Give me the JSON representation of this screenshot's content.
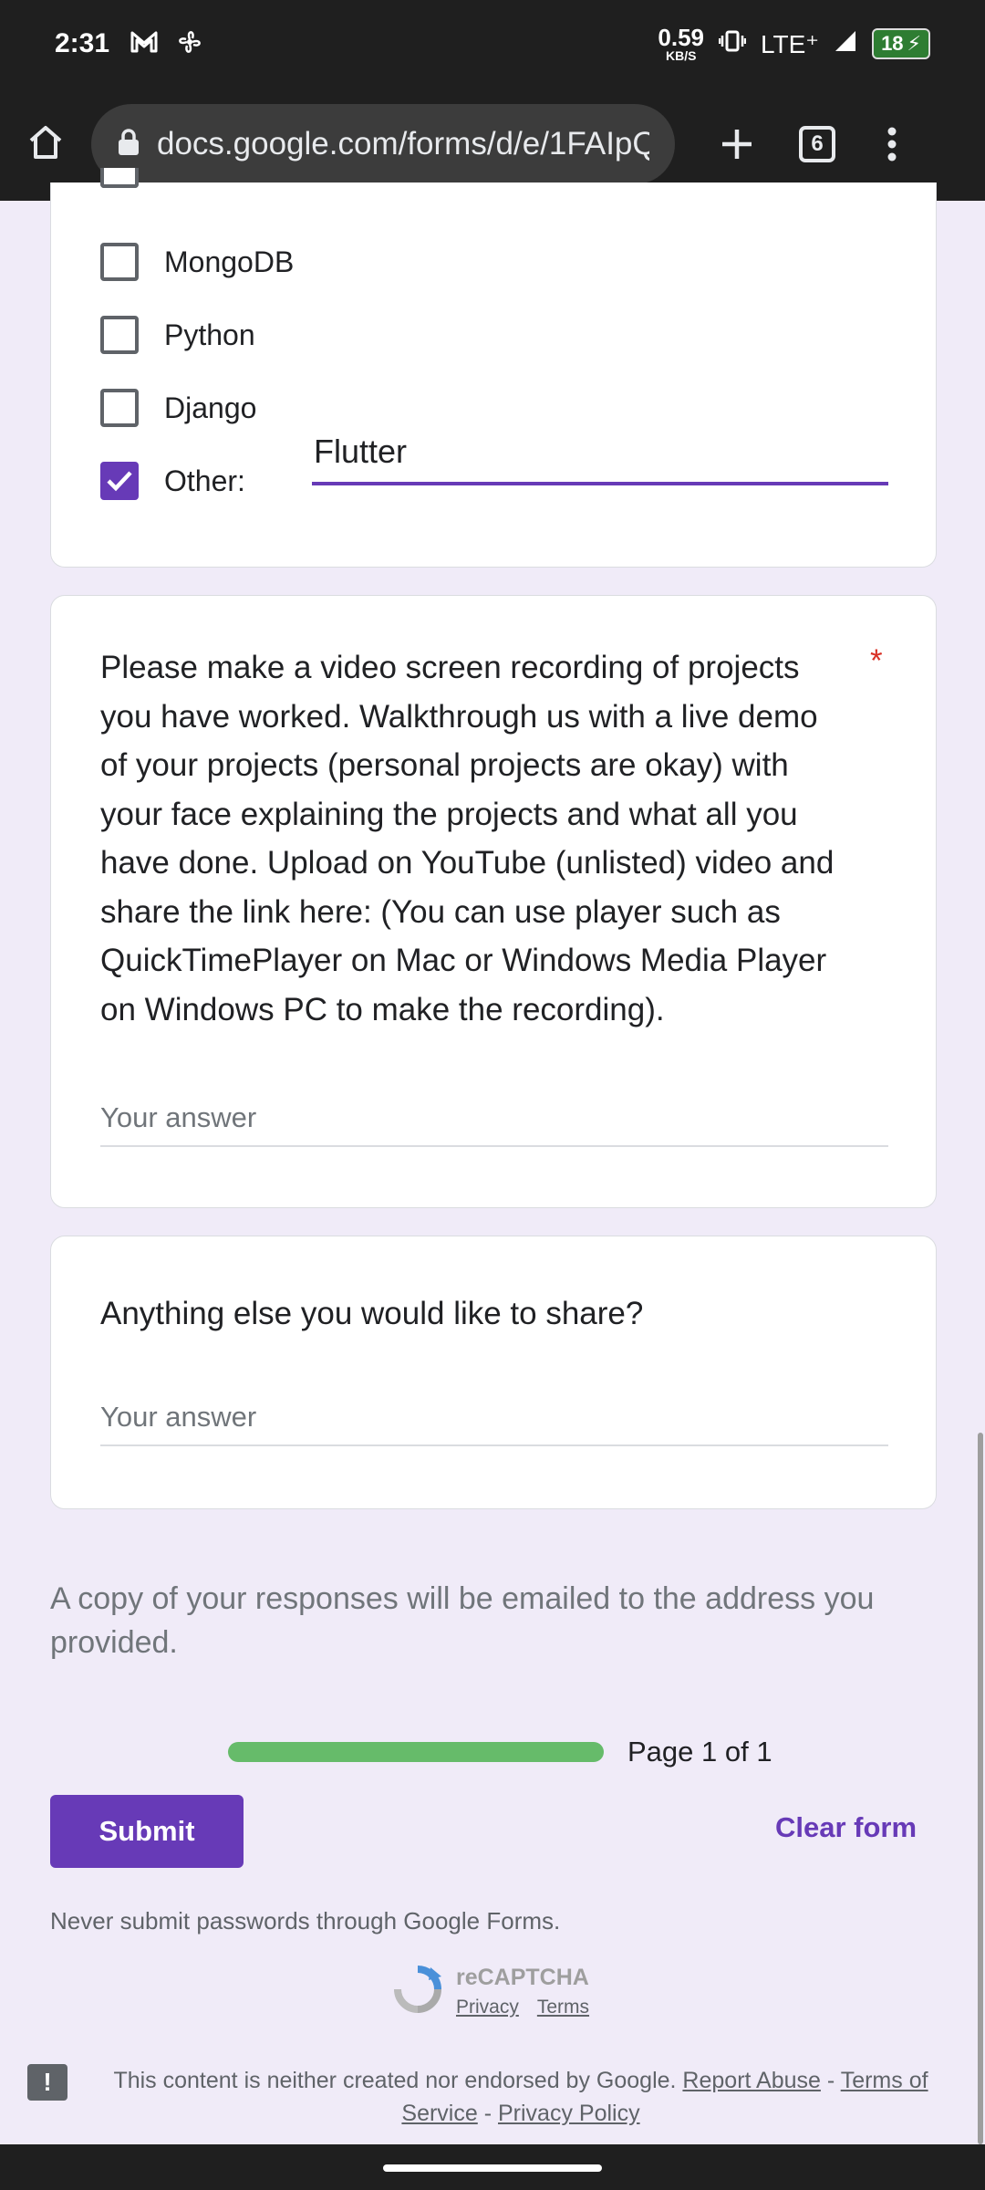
{
  "status_bar": {
    "time": "2:31",
    "speed_value": "0.59",
    "speed_unit": "KB/S",
    "network": "LTE⁺",
    "battery": "18"
  },
  "browser": {
    "url": "docs.google.com/forms/d/e/1FAIpQLSe",
    "tab_count": "6"
  },
  "form": {
    "options": [
      {
        "label": "MongoDB",
        "checked": false
      },
      {
        "label": "Python",
        "checked": false
      },
      {
        "label": "Django",
        "checked": false
      },
      {
        "label": "Other:",
        "checked": true
      }
    ],
    "other_value": "Flutter",
    "question_video": "Please make a video screen recording of projects you have worked. Walkthrough us with a live demo of your projects (personal projects are okay) with your face explaining the projects and what all you have done. Upload on YouTube (unlisted) video and share the link here: (You can use player such as QuickTimePlayer on Mac or Windows Media Player on Windows PC to make the recording).",
    "required_mark": "*",
    "answer_placeholder": "Your answer",
    "question_else": "Anything else you would like to share?",
    "copy_notice": "A copy of your responses will be emailed to the address you provided.",
    "progress_fraction": 1.0,
    "page_text": "Page 1 of 1",
    "submit_label": "Submit",
    "clear_label": "Clear form",
    "password_warning": "Never submit passwords through Google Forms."
  },
  "recaptcha": {
    "title": "reCAPTCHA",
    "privacy": "Privacy",
    "terms": "Terms"
  },
  "footer": {
    "text": "This content is neither created nor endorsed by Google.",
    "report_abuse": "Report Abuse",
    "sep1": " - ",
    "terms_of_service": "Terms of Service",
    "sep2": " - ",
    "privacy_policy": "Privacy Policy"
  },
  "colors": {
    "accent": "#673ab7",
    "progress": "#4caf50",
    "required": "#d93025",
    "background": "#f0ebf8"
  }
}
